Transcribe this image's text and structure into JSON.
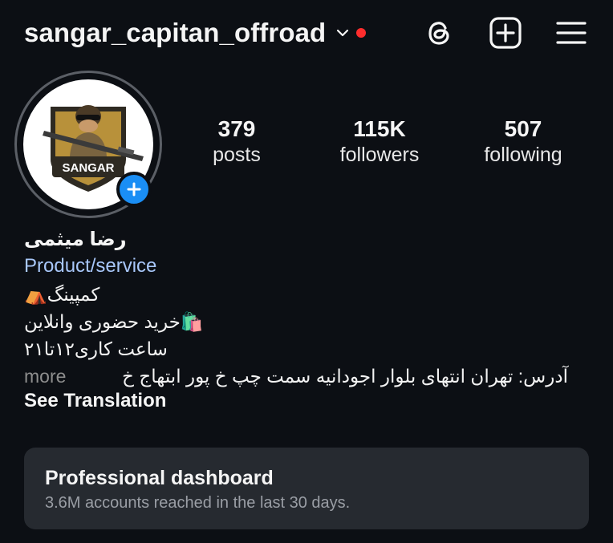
{
  "header": {
    "username": "sangar_capitan_offroad",
    "icons": [
      "chevron-down-icon",
      "threads-icon",
      "new-post-icon",
      "menu-icon"
    ],
    "notification_dot_color": "#ff2d2d"
  },
  "profile": {
    "avatar_text": "SANGAR",
    "stats": [
      {
        "value": "379",
        "label": "posts"
      },
      {
        "value": "115K",
        "label": "followers"
      },
      {
        "value": "507",
        "label": "following"
      }
    ],
    "name": "رضا میثمی",
    "category": "Product/service",
    "bio": [
      "کمپینگ⛺",
      "🛍️خرید حضوری وانلاین",
      "ساعت کاری۱۲تا۲۱",
      "آدرس: تهران انتهای بلوار اجودانیه سمت چپ خ پور ابتهاج خ"
    ],
    "more_label": "more",
    "see_translation": "See Translation"
  },
  "dashboard": {
    "title": "Professional dashboard",
    "subtitle": "3.6M accounts reached in the last 30 days."
  },
  "colors": {
    "background": "#0c0f14",
    "accent_blue": "#1a8ef5",
    "link_blue": "#a8c7fa",
    "card": "#262a30"
  }
}
